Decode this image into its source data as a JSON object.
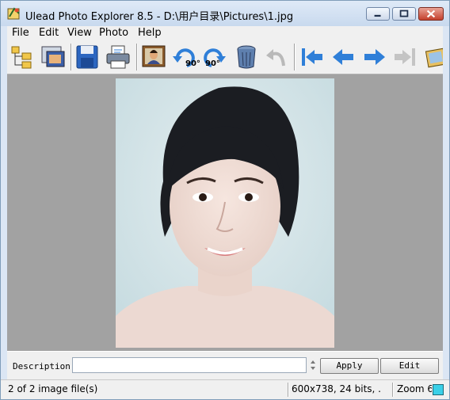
{
  "window": {
    "title": "Ulead Photo Explorer 8.5 - D:\\用户目录\\Pictures\\1.jpg",
    "icon": "ulead-app-icon",
    "controls": [
      "minimize-icon",
      "maximize-icon",
      "close-icon"
    ]
  },
  "menu": {
    "items": [
      "File",
      "Edit",
      "View",
      "Photo",
      "Help"
    ]
  },
  "toolbar": {
    "buttons": [
      {
        "name": "browse-folders-icon"
      },
      {
        "name": "slideshow-window-icon"
      },
      {
        "name": "save-icon"
      },
      {
        "name": "print-icon"
      },
      {
        "name": "portrait-photo-icon"
      },
      {
        "name": "rotate-left-icon",
        "label": "90°"
      },
      {
        "name": "rotate-right-icon",
        "label": "90°"
      },
      {
        "name": "trash-can-icon"
      },
      {
        "name": "undo-icon"
      },
      {
        "name": "first-image-icon"
      },
      {
        "name": "previous-image-icon"
      },
      {
        "name": "next-image-icon"
      },
      {
        "name": "last-image-icon"
      },
      {
        "name": "slideshow-icon"
      }
    ]
  },
  "description": {
    "label": "Description:",
    "value": "",
    "apply_label": "Apply",
    "edit_label": "Edit"
  },
  "status": {
    "file_count": "2 of 2 image file(s)",
    "image_info": "600x738, 24 bits, .",
    "zoom": "Zoom 6"
  },
  "colors": {
    "toolbar_blue": "#2f7fd8",
    "viewer_bg": "#a2a2a2",
    "zoom_indicator": "#3ad0e8"
  }
}
